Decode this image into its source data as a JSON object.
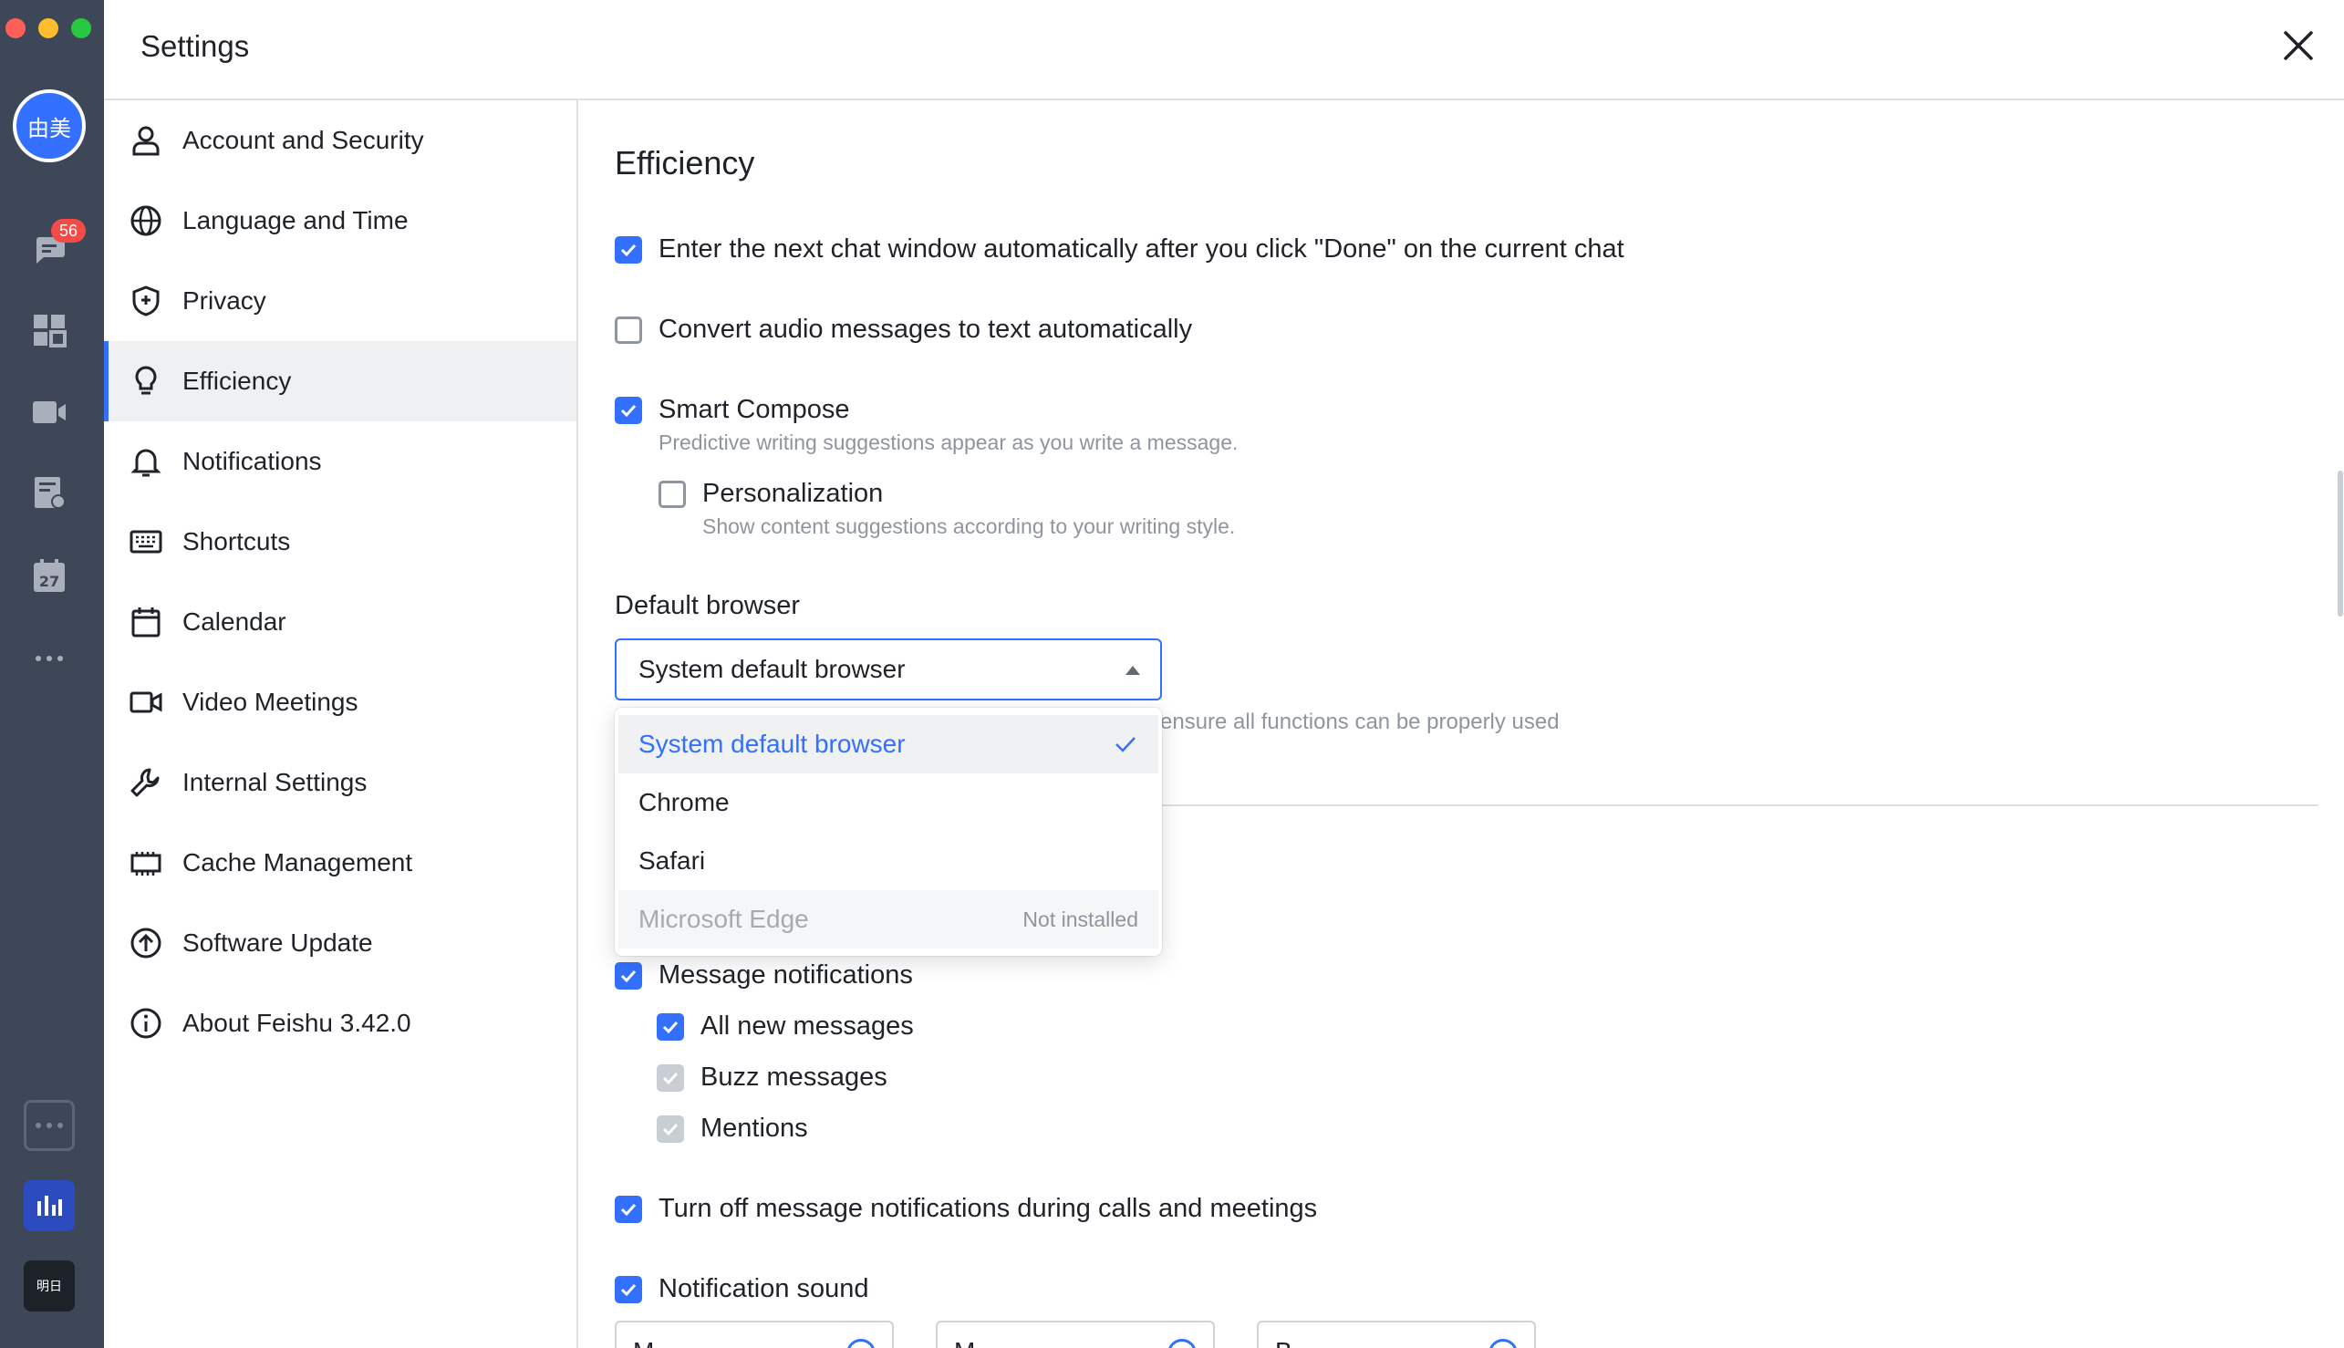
{
  "rail": {
    "avatar_text": "由美",
    "chat_badge": "56",
    "app_dark_label": "明日",
    "icons": [
      "chat-icon",
      "workplace-icon",
      "video-icon",
      "docs-icon",
      "calendar-icon",
      "more-icon"
    ]
  },
  "header": {
    "title": "Settings"
  },
  "nav": {
    "items": [
      {
        "label": "Account and Security",
        "icon": "person-icon"
      },
      {
        "label": "Language and Time",
        "icon": "globe-icon"
      },
      {
        "label": "Privacy",
        "icon": "shield-icon"
      },
      {
        "label": "Efficiency",
        "icon": "lightbulb-icon",
        "active": true
      },
      {
        "label": "Notifications",
        "icon": "bell-icon"
      },
      {
        "label": "Shortcuts",
        "icon": "keyboard-icon"
      },
      {
        "label": "Calendar",
        "icon": "calendar-icon"
      },
      {
        "label": "Video Meetings",
        "icon": "video-camera-icon"
      },
      {
        "label": "Internal Settings",
        "icon": "wrench-icon"
      },
      {
        "label": "Cache Management",
        "icon": "memory-icon"
      },
      {
        "label": "Software Update",
        "icon": "upload-arrow-icon"
      },
      {
        "label": "About Feishu 3.42.0",
        "icon": "info-icon"
      }
    ]
  },
  "content": {
    "section_title": "Efficiency",
    "auto_next_chat": {
      "label": "Enter the next chat window automatically after you click \"Done\" on the current chat",
      "checked": true
    },
    "audio_to_text": {
      "label": "Convert audio messages to text automatically",
      "checked": false
    },
    "smart_compose": {
      "label": "Smart Compose",
      "desc": "Predictive writing suggestions appear as you write a message.",
      "checked": true
    },
    "personalization": {
      "label": "Personalization",
      "desc": "Show content suggestions according to your writing style.",
      "checked": false
    },
    "default_browser": {
      "label": "Default browser",
      "value": "System default browser",
      "hint_visible": "ensure all functions can be properly used",
      "options": [
        {
          "label": "System default browser",
          "selected": true
        },
        {
          "label": "Chrome"
        },
        {
          "label": "Safari"
        },
        {
          "label": "Microsoft Edge",
          "tag": "Not installed",
          "disabled": true
        }
      ]
    },
    "message_notifications": {
      "label": "Message notifications",
      "checked": true
    },
    "all_new_messages": {
      "label": "All new messages",
      "checked": true
    },
    "buzz_messages": {
      "label": "Buzz messages",
      "checked": true,
      "disabled": true
    },
    "mentions": {
      "label": "Mentions",
      "checked": true,
      "disabled": true
    },
    "mute_during_calls": {
      "label": "Turn off message notifications during calls and meetings",
      "checked": true
    },
    "notification_sound": {
      "label": "Notification sound",
      "checked": true
    },
    "sound_boxes": [
      "M",
      "M",
      "B"
    ]
  },
  "colors": {
    "accent": "#3370ff",
    "rail": "#3d4757",
    "badge": "#f54a45",
    "active_nav": "#eff0f1"
  }
}
